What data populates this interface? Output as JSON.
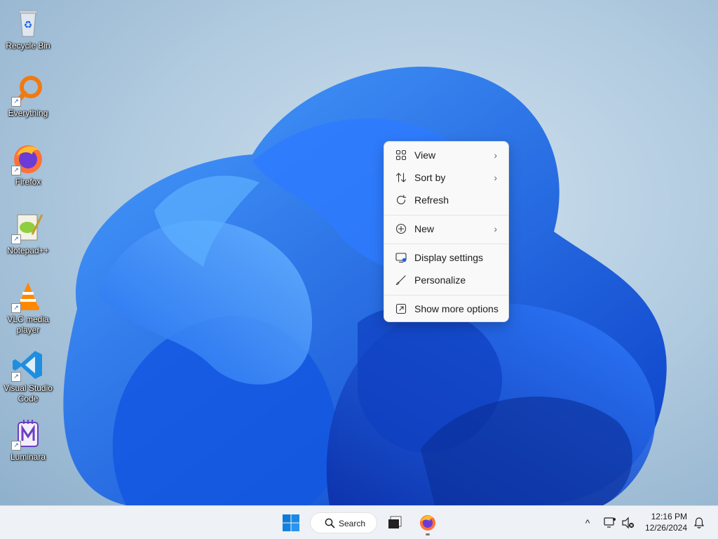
{
  "desktop": {
    "icons": [
      {
        "label": "Recycle Bin",
        "icon": "recycle-bin-icon"
      },
      {
        "label": "Everything",
        "icon": "everything-search-icon"
      },
      {
        "label": "Firefox",
        "icon": "firefox-icon"
      },
      {
        "label": "Notepad++",
        "icon": "notepadpp-icon"
      },
      {
        "label": "VLC media player",
        "icon": "vlc-icon"
      },
      {
        "label": "Visual Studio Code",
        "icon": "vscode-icon"
      },
      {
        "label": "Luminara",
        "icon": "luminara-icon"
      }
    ]
  },
  "context_menu": {
    "items": [
      {
        "label": "View",
        "icon": "grid-view-icon",
        "submenu": true
      },
      {
        "label": "Sort by",
        "icon": "sort-icon",
        "submenu": true
      },
      {
        "label": "Refresh",
        "icon": "refresh-icon",
        "submenu": false
      },
      {
        "label": "New",
        "icon": "plus-circle-icon",
        "submenu": true
      },
      {
        "label": "Display settings",
        "icon": "display-settings-icon",
        "submenu": false
      },
      {
        "label": "Personalize",
        "icon": "brush-icon",
        "submenu": false
      },
      {
        "label": "Show more options",
        "icon": "open-external-icon",
        "submenu": false
      }
    ],
    "chevron": "›"
  },
  "taskbar": {
    "search_label": "Search",
    "time": "12:16 PM",
    "date": "12/26/2024",
    "tray_chevron": "^"
  },
  "colors": {
    "accent": "#1a63e8",
    "taskbar_bg": "#eef1f5",
    "menu_bg": "#f9f9f9"
  }
}
